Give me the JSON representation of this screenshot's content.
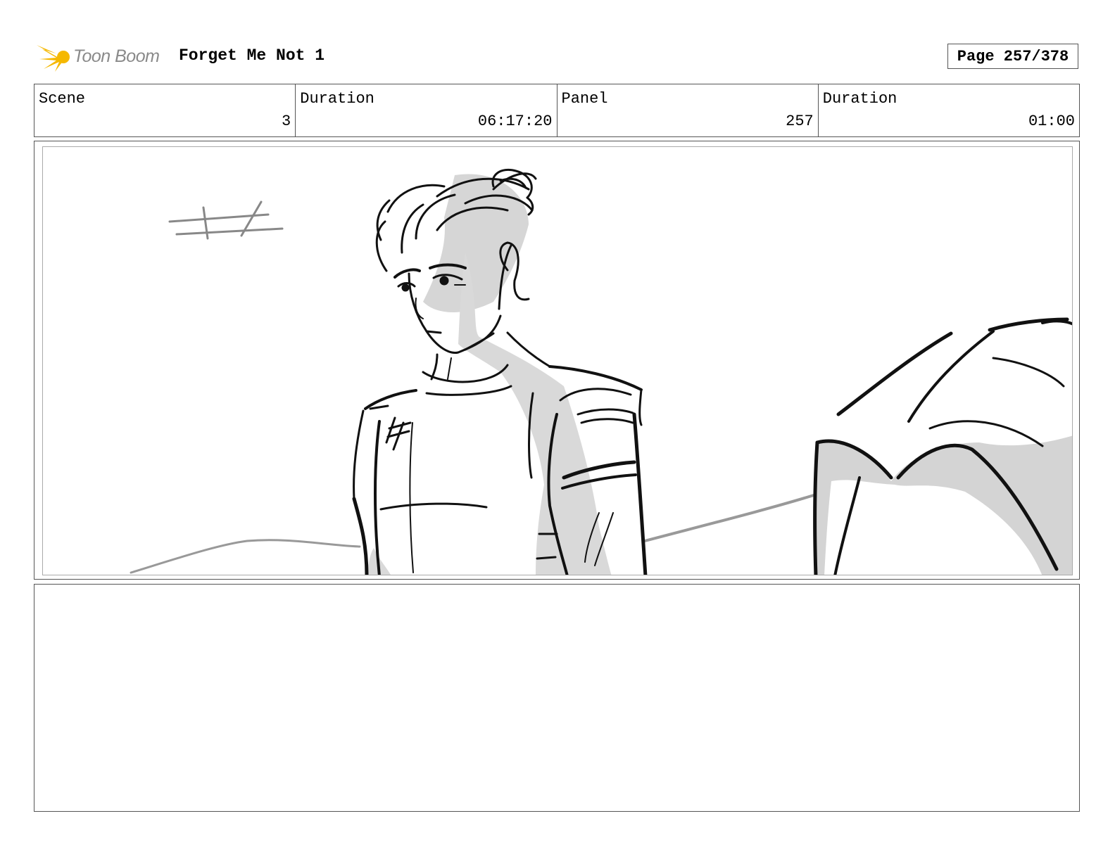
{
  "header": {
    "logo_text": "Toon Boom",
    "title": "Forget Me Not 1",
    "page_label": "Page 257/378"
  },
  "info": [
    {
      "label": "Scene",
      "value": "3"
    },
    {
      "label": "Duration",
      "value": "06:17:20"
    },
    {
      "label": "Panel",
      "value": "257"
    },
    {
      "label": "Duration",
      "value": "01:00"
    }
  ],
  "notes": {
    "text": ""
  },
  "colors": {
    "logo_star": "#f5b800",
    "logo_text": "#8a8a8a",
    "frame_border": "#555555",
    "sketch_shade": "#d3d3d3"
  },
  "icons": {
    "logo_mark": "star-burst-icon"
  }
}
